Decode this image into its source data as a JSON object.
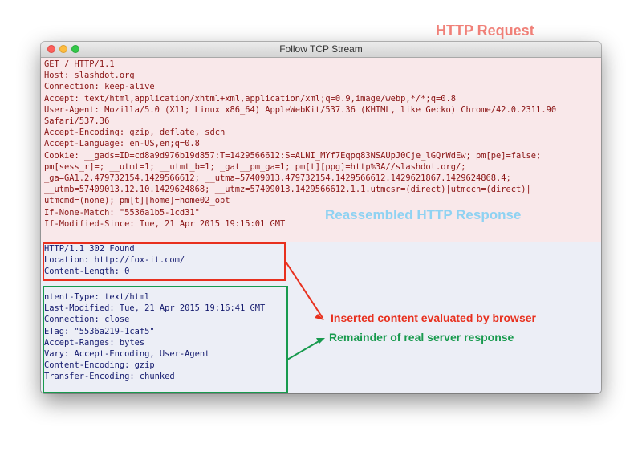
{
  "window": {
    "title": "Follow TCP Stream"
  },
  "request": {
    "label": "HTTP Request",
    "lines": [
      "GET / HTTP/1.1",
      "Host: slashdot.org",
      "Connection: keep-alive",
      "Accept: text/html,application/xhtml+xml,application/xml;q=0.9,image/webp,*/*;q=0.8",
      "User-Agent: Mozilla/5.0 (X11; Linux x86_64) AppleWebKit/537.36 (KHTML, like Gecko) Chrome/42.0.2311.90",
      "Safari/537.36",
      "Accept-Encoding: gzip, deflate, sdch",
      "Accept-Language: en-US,en;q=0.8",
      "Cookie: __gads=ID=cd8a9d976b19d857:T=1429566612:S=ALNI_MYf7Eqpq83NSAUpJ0Cje_lGQrWdEw; pm[pe]=false;",
      "pm[sess_r]=; __utmt=1; __utmt_b=1; _gat__pm_ga=1; pm[t][ppg]=http%3A//slashdot.org/;",
      "_ga=GA1.2.479732154.1429566612; __utma=57409013.479732154.1429566612.1429621867.1429624868.4;",
      "__utmb=57409013.12.10.1429624868; __utmz=57409013.1429566612.1.1.utmcsr=(direct)|utmccn=(direct)|",
      "utmcmd=(none); pm[t][home]=home02_opt",
      "If-None-Match: \"5536a1b5-1cd31\"",
      "If-Modified-Since: Tue, 21 Apr 2015 19:15:01 GMT"
    ]
  },
  "response": {
    "label": "Reassembled HTTP Response",
    "inserted_lines": [
      "HTTP/1.1 302 Found",
      "Location: http://fox-it.com/",
      "Content-Length: 0"
    ],
    "real_lines": [
      "ntent-Type: text/html",
      "Last-Modified: Tue, 21 Apr 2015 19:16:41 GMT",
      "Connection: close",
      "ETag: \"5536a219-1caf5\"",
      "Accept-Ranges: bytes",
      "Vary: Accept-Encoding, User-Agent",
      "Content-Encoding: gzip",
      "Transfer-Encoding: chunked"
    ]
  },
  "annotations": {
    "inserted": "Inserted content evaluated by browser",
    "real": "Remainder of real server response"
  },
  "colors": {
    "request_bg": "#f9e8ea",
    "request_text": "#8a1414",
    "response_bg": "#eceef6",
    "response_text": "#141a6e",
    "inserted_box": "#e8301e",
    "real_box": "#189a4e"
  }
}
